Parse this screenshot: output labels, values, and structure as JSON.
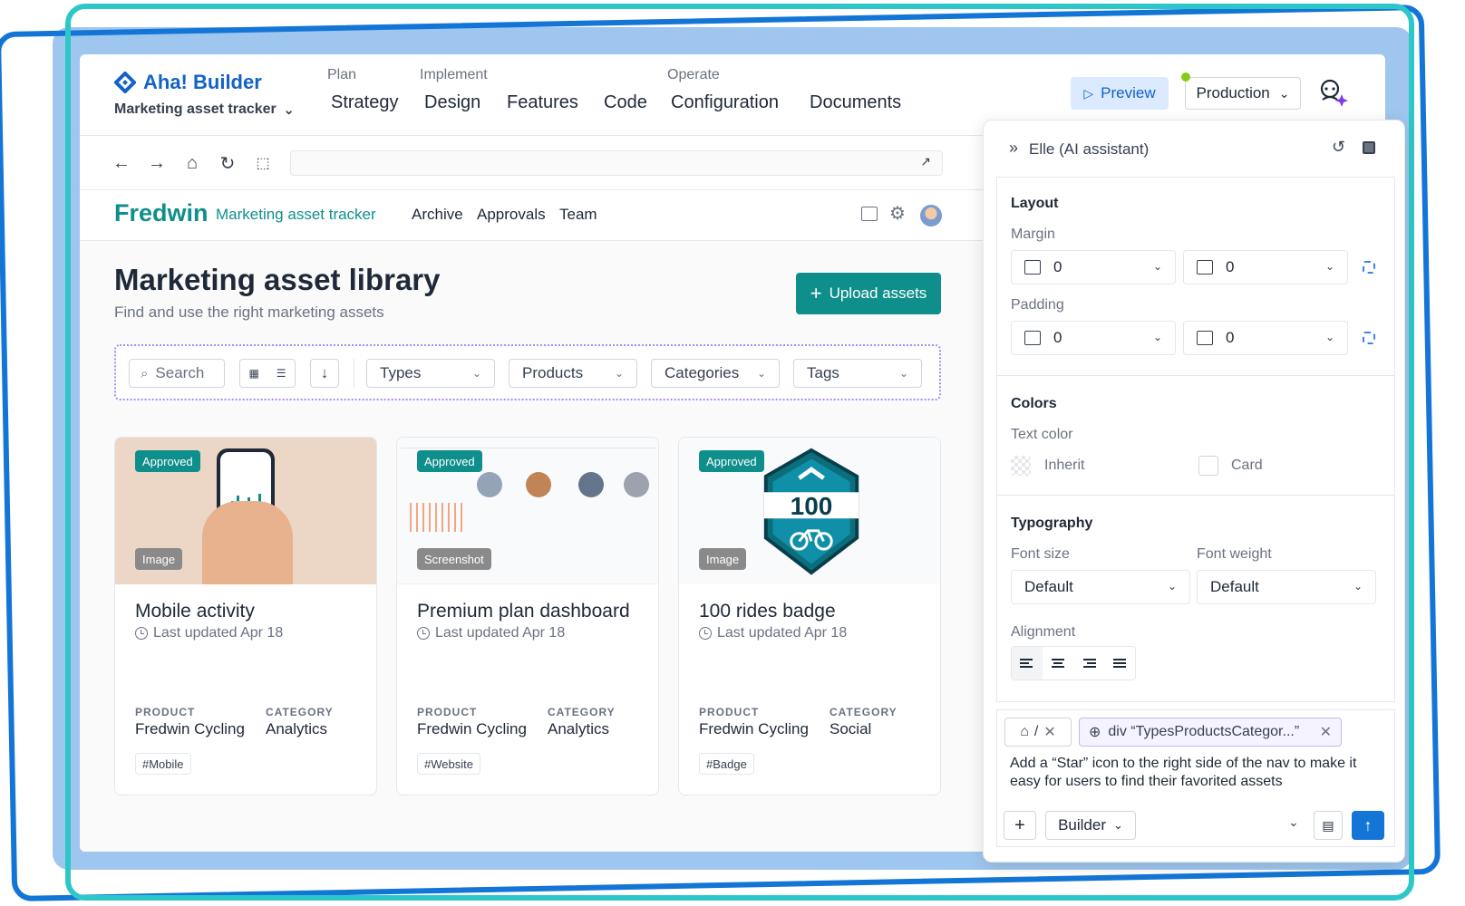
{
  "app": {
    "logo": "Aha! Builder",
    "product_selector": "Marketing asset tracker",
    "nav_groups": {
      "plan": "Plan",
      "implement": "Implement",
      "operate": "Operate"
    },
    "nav_items": [
      "Strategy",
      "Design",
      "Features",
      "Code",
      "Configuration",
      "Documents"
    ],
    "preview_label": "Preview",
    "environment": "Production",
    "accent_color": "#1262c7"
  },
  "site": {
    "brand": "Fredwin",
    "brand_sub": "Marketing asset tracker",
    "links": [
      "Archive",
      "Approvals",
      "Team"
    ],
    "page_title": "Marketing asset library",
    "page_sub": "Find and use the right marketing assets",
    "upload_label": "Upload assets",
    "search_placeholder": "Search",
    "filters": [
      "Types",
      "Products",
      "Categories",
      "Tags"
    ],
    "brand_color": "#0f8f8c",
    "cards": [
      {
        "status": "Approved",
        "type": "Image",
        "title": "Mobile activity",
        "updated": "Last updated Apr 18",
        "product_label": "PRODUCT",
        "product": "Fredwin Cycling",
        "category_label": "CATEGORY",
        "category": "Analytics",
        "tag": "#Mobile"
      },
      {
        "status": "Approved",
        "type": "Screenshot",
        "title": "Premium plan dashboard",
        "updated": "Last updated Apr 18",
        "product_label": "PRODUCT",
        "product": "Fredwin Cycling",
        "category_label": "CATEGORY",
        "category": "Analytics",
        "tag": "#Website"
      },
      {
        "status": "Approved",
        "type": "Image",
        "title": "100 rides badge",
        "updated": "Last updated Apr 18",
        "product_label": "PRODUCT",
        "product": "Fredwin Cycling",
        "category_label": "CATEGORY",
        "category": "Social",
        "tag": "#Badge",
        "badge_number": "100"
      }
    ]
  },
  "panel": {
    "title": "Elle (AI assistant)",
    "layout": {
      "title": "Layout",
      "margin_label": "Margin",
      "padding_label": "Padding",
      "margin_x": "0",
      "margin_y": "0",
      "padding_x": "0",
      "padding_y": "0"
    },
    "colors": {
      "title": "Colors",
      "text_color_label": "Text color",
      "inherit": "Inherit",
      "card": "Card"
    },
    "typography": {
      "title": "Typography",
      "font_size_label": "Font size",
      "font_weight_label": "Font weight",
      "font_size": "Default",
      "font_weight": "Default",
      "alignment_label": "Alignment"
    },
    "context_chip": "div “TypesProductsCategor...”",
    "prompt": "Add a “Star” icon to the right side of the nav to make it easy for users to find their favorited assets",
    "mode": "Builder"
  }
}
